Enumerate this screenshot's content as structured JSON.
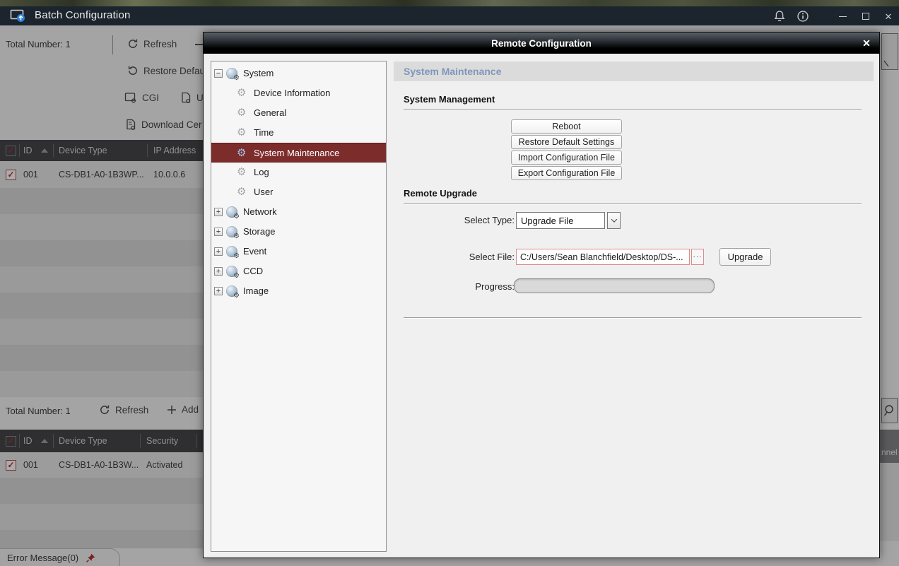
{
  "colors": {
    "titlebar_bg": "#1c252e",
    "selected_item_maroon": "#7d2c2c",
    "page_title_blue": "#7e97bd",
    "file_field_alert_border": "#dd8a8a",
    "pin_red": "#b5312f"
  },
  "glyphs": {
    "check": "✓",
    "close": "✕",
    "gear": "⚙",
    "collapse": "−",
    "expand": "+",
    "ellipsis": "···"
  },
  "window": {
    "title": "Batch Configuration"
  },
  "main_window": {
    "top_toolbar": {
      "total_number": "Total Number: 1",
      "refresh": "Refresh",
      "restore_defaults": "Restore Defau",
      "cgi": "CGI",
      "upload_partial": "U",
      "download_cert": "Download Cer"
    },
    "device_table": {
      "columns": {
        "id": "ID",
        "device_type": "Device Type",
        "ip_address": "IP Address"
      },
      "row": {
        "id": "001",
        "device_type": "CS-DB1-A0-1B3WP...",
        "ip_address": "10.0.0.6"
      }
    },
    "bottom_toolbar": {
      "total_number": "Total Number: 1",
      "refresh": "Refresh",
      "add": "Add"
    },
    "bottom_table": {
      "columns": {
        "id": "ID",
        "device_type": "Device Type",
        "security": "Security"
      },
      "row": {
        "id": "001",
        "device_type": "CS-DB1-A0-1B3W...",
        "security": "Activated"
      }
    },
    "error_tab": {
      "label": "Error Message(0)"
    },
    "right_panel": {
      "partial_column": "nnel"
    }
  },
  "dialog": {
    "title": "Remote Configuration",
    "tree": {
      "items": [
        {
          "label": "System"
        },
        {
          "label": "Device Information"
        },
        {
          "label": "General"
        },
        {
          "label": "Time"
        },
        {
          "label": "System Maintenance"
        },
        {
          "label": "Log"
        },
        {
          "label": "User"
        },
        {
          "label": "Network"
        },
        {
          "label": "Storage"
        },
        {
          "label": "Event"
        },
        {
          "label": "CCD"
        },
        {
          "label": "Image"
        }
      ]
    },
    "content": {
      "page_title": "System Maintenance",
      "system_management": {
        "heading": "System Management",
        "reboot": "Reboot",
        "restore_defaults": "Restore Default Settings",
        "import_config": "Import Configuration File",
        "export_config": "Export Configuration File"
      },
      "remote_upgrade": {
        "heading": "Remote Upgrade",
        "select_type_label": "Select Type:",
        "select_type_value": "Upgrade File",
        "select_file_label": "Select File:",
        "select_file_value": "C:/Users/Sean Blanchfield/Desktop/DS-...",
        "upgrade": "Upgrade",
        "progress_label": "Progress:"
      }
    }
  }
}
